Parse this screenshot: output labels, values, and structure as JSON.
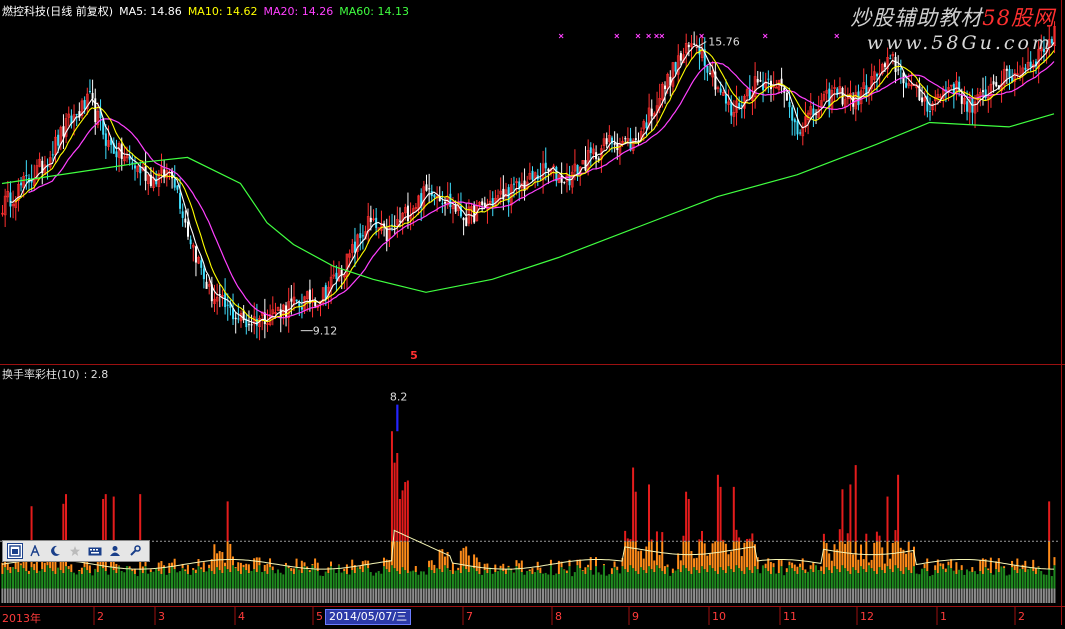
{
  "header": {
    "title": "燃控科技(日线 前复权)",
    "ma5": "MA5: 14.86",
    "ma10": "MA10: 14.62",
    "ma20": "MA20: 14.26",
    "ma60": "MA60: 14.13",
    "colors": {
      "title": "#ffffff",
      "ma5": "#ffffff",
      "ma10": "#ffff00",
      "ma20": "#ff40ff",
      "ma60": "#40ff40"
    }
  },
  "watermark": {
    "line1": "炒股辅助教材",
    "line1_red": "58股网",
    "line2": "www.58Gu.com"
  },
  "sub": {
    "title": "换手率彩柱(10)",
    "value": ": 2.8"
  },
  "toolbar": {
    "icons": [
      "window-icon",
      "text-icon",
      "moon-icon",
      "star-icon",
      "keyboard-icon",
      "person-icon",
      "wrench-icon"
    ]
  },
  "chart_data": [
    {
      "type": "candlestick",
      "title": "燃控科技(日线 前复权)",
      "series": [
        {
          "name": "MA5",
          "color": "#ffffff"
        },
        {
          "name": "MA10",
          "color": "#ffff00"
        },
        {
          "name": "MA20",
          "color": "#ff40ff"
        },
        {
          "name": "MA60",
          "color": "#40ff40"
        }
      ],
      "annotations": [
        {
          "text": "15.76",
          "value": 15.76
        },
        {
          "text": "9.12",
          "value": 9.12
        },
        {
          "text": "5"
        }
      ],
      "ylim": [
        8.4,
        16.6
      ],
      "anchors": [
        [
          0,
          12.0
        ],
        [
          15,
          12.9
        ],
        [
          25,
          13.9
        ],
        [
          33,
          14.4
        ],
        [
          40,
          13.4
        ],
        [
          50,
          12.9
        ],
        [
          57,
          12.6
        ],
        [
          64,
          12.8
        ],
        [
          70,
          11.4
        ],
        [
          78,
          10.0
        ],
        [
          85,
          9.6
        ],
        [
          92,
          9.3
        ],
        [
          100,
          9.5
        ],
        [
          110,
          9.7
        ],
        [
          120,
          9.9
        ],
        [
          130,
          10.7
        ],
        [
          138,
          11.6
        ],
        [
          145,
          11.3
        ],
        [
          155,
          12.0
        ],
        [
          162,
          12.4
        ],
        [
          168,
          12.1
        ],
        [
          175,
          11.7
        ],
        [
          185,
          12.1
        ],
        [
          195,
          12.4
        ],
        [
          205,
          12.8
        ],
        [
          213,
          12.6
        ],
        [
          220,
          13.0
        ],
        [
          230,
          13.5
        ],
        [
          238,
          13.4
        ],
        [
          247,
          14.4
        ],
        [
          255,
          15.3
        ],
        [
          262,
          15.8
        ],
        [
          268,
          15.0
        ],
        [
          275,
          14.1
        ],
        [
          284,
          14.8
        ],
        [
          292,
          14.9
        ],
        [
          300,
          13.8
        ],
        [
          306,
          14.1
        ],
        [
          314,
          14.6
        ],
        [
          322,
          14.4
        ],
        [
          330,
          15.0
        ],
        [
          336,
          15.3
        ],
        [
          344,
          14.6
        ],
        [
          350,
          14.3
        ],
        [
          358,
          14.8
        ],
        [
          366,
          14.2
        ],
        [
          374,
          14.8
        ],
        [
          382,
          15.0
        ],
        [
          390,
          15.4
        ],
        [
          397,
          15.9
        ]
      ],
      "ma60": [
        [
          0,
          12.5
        ],
        [
          55,
          13.0
        ],
        [
          70,
          13.1
        ],
        [
          90,
          12.5
        ],
        [
          100,
          11.6
        ],
        [
          110,
          11.1
        ],
        [
          125,
          10.6
        ],
        [
          140,
          10.3
        ],
        [
          160,
          10.0
        ],
        [
          185,
          10.3
        ],
        [
          210,
          10.8
        ],
        [
          240,
          11.5
        ],
        [
          270,
          12.2
        ],
        [
          300,
          12.7
        ],
        [
          330,
          13.4
        ],
        [
          350,
          13.9
        ],
        [
          380,
          13.8
        ],
        [
          397,
          14.1
        ]
      ]
    },
    {
      "type": "bar",
      "title": "换手率彩柱(10)",
      "value_label": "2.8",
      "peak_label": "8.2",
      "peak_value": 8.2,
      "ylim": [
        0,
        9.3
      ],
      "x_ticks": [
        "2013年",
        "2",
        "3",
        "4",
        "5",
        "2014/05/07/三",
        "7",
        "8",
        "9",
        "10",
        "11",
        "12",
        "1",
        "2"
      ],
      "colors": {
        "low": "#1f8a1f",
        "mid": "#ff8c1a",
        "high": "#e41c1c",
        "peak": "#2525ff",
        "base": "#8c8c8c",
        "ma": "#f5f5b4",
        "ref": "#9a9a9a"
      }
    }
  ]
}
